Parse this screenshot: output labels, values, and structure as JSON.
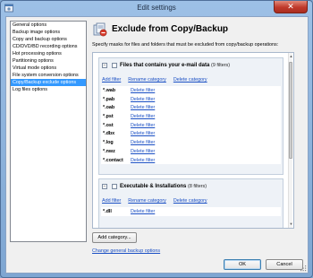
{
  "window": {
    "title": "Edit settings",
    "close_glyph": "✕"
  },
  "sidebar": {
    "items": [
      {
        "label": "General options",
        "selected": false
      },
      {
        "label": "Backup image options",
        "selected": false
      },
      {
        "label": "Copy and backup options",
        "selected": false
      },
      {
        "label": "CD/DVD/BD recording options",
        "selected": false
      },
      {
        "label": "Hot processing options",
        "selected": false
      },
      {
        "label": "Partitioning options",
        "selected": false
      },
      {
        "label": "Virtual mode options",
        "selected": false
      },
      {
        "label": "File system conversion options",
        "selected": false
      },
      {
        "label": "Copy/Backup exclude options",
        "selected": true
      },
      {
        "label": "Log files options",
        "selected": false
      }
    ]
  },
  "main": {
    "title": "Exclude from Copy/Backup",
    "description": "Specify masks for files and folders that must be excluded from copy/backup operations:",
    "groups": [
      {
        "toggle": "−",
        "name": "Files that contains your e-mail data",
        "count": "(9 filters)",
        "links": {
          "add": "Add filter",
          "rename": "Rename category",
          "delete": "Delete category"
        },
        "filters": [
          {
            "mask": "*.wab",
            "delete": "Delete filter"
          },
          {
            "mask": "*.pab",
            "delete": "Delete filter"
          },
          {
            "mask": "*.oab",
            "delete": "Delete filter"
          },
          {
            "mask": "*.pst",
            "delete": "Delete filter"
          },
          {
            "mask": "*.ost",
            "delete": "Delete filter"
          },
          {
            "mask": "*.dbx",
            "delete": "Delete filter"
          },
          {
            "mask": "*.log",
            "delete": "Delete filter"
          },
          {
            "mask": "*.nwz",
            "delete": "Delete filter"
          },
          {
            "mask": "*.contact",
            "delete": "Delete filter"
          }
        ]
      },
      {
        "toggle": "−",
        "name": "Executable & Installations",
        "count": "(8 filters)",
        "links": {
          "add": "Add filter",
          "rename": "Rename category",
          "delete": "Delete category"
        },
        "filters": [
          {
            "mask": "*.dll",
            "delete": "Delete filter"
          }
        ]
      }
    ],
    "add_category_label": "Add category...",
    "change_link": "Change general backup options"
  },
  "footer": {
    "ok_label": "OK",
    "cancel_label": "Cancel"
  },
  "colors": {
    "selection": "#3399ff",
    "link": "#1a4fc4",
    "close": "#c0392b"
  },
  "icons": {
    "app": "gear-window-icon",
    "header": "exclude-files-icon",
    "resize": "resize-grip-icon"
  }
}
